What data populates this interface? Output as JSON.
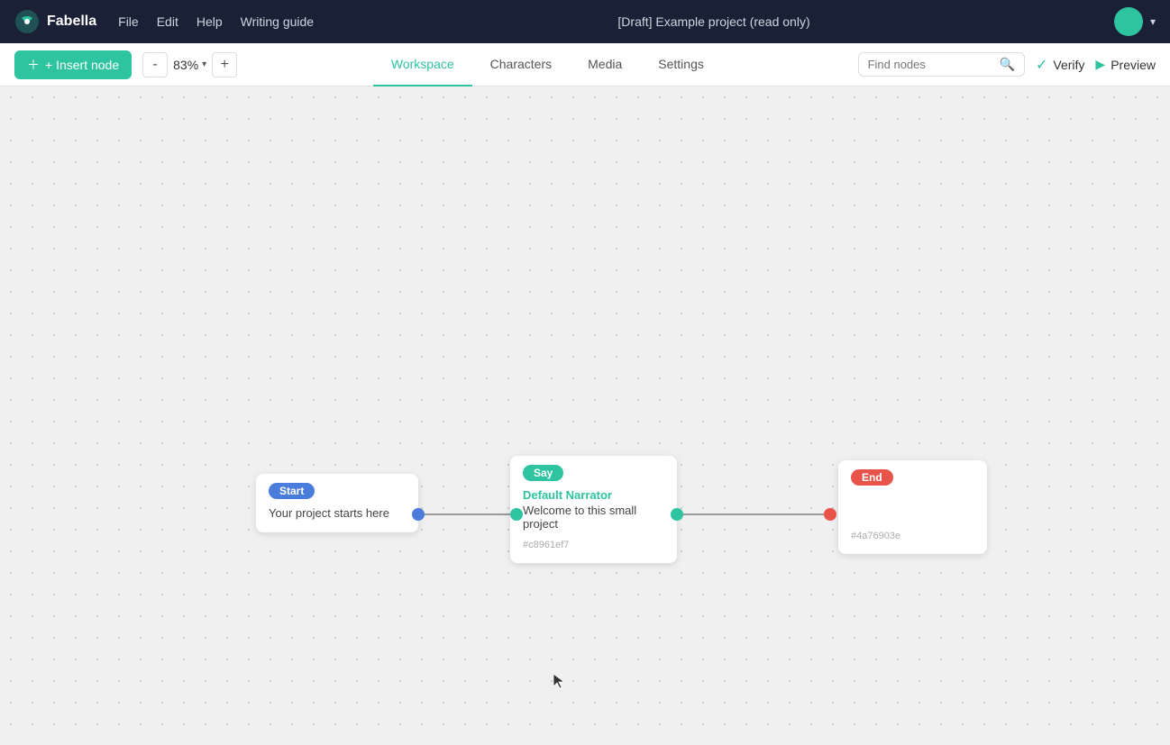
{
  "app": {
    "name": "Fabella"
  },
  "navbar": {
    "file_label": "File",
    "edit_label": "Edit",
    "help_label": "Help",
    "writing_guide_label": "Writing guide",
    "project_title": "[Draft] Example project  (read only)"
  },
  "toolbar": {
    "insert_node_label": "+ Insert node",
    "zoom_minus": "-",
    "zoom_value": "83%",
    "zoom_caret": "▾",
    "zoom_plus": "+"
  },
  "tabs": [
    {
      "id": "workspace",
      "label": "Workspace",
      "active": true
    },
    {
      "id": "characters",
      "label": "Characters",
      "active": false
    },
    {
      "id": "media",
      "label": "Media",
      "active": false
    },
    {
      "id": "settings",
      "label": "Settings",
      "active": false
    }
  ],
  "search": {
    "placeholder": "Find nodes"
  },
  "verify": {
    "label": "Verify"
  },
  "preview": {
    "label": "Preview"
  },
  "nodes": {
    "start": {
      "badge": "Start",
      "text": "Your project starts here"
    },
    "say": {
      "badge": "Say",
      "narrator": "Default Narrator",
      "text": "Welcome to this small project",
      "id": "#c8961ef7"
    },
    "end": {
      "badge": "End",
      "id": "#4a76903e"
    }
  },
  "colors": {
    "teal": "#2ec4a0",
    "blue": "#4a7cdc",
    "red": "#e8534a",
    "navy": "#1a2035"
  }
}
